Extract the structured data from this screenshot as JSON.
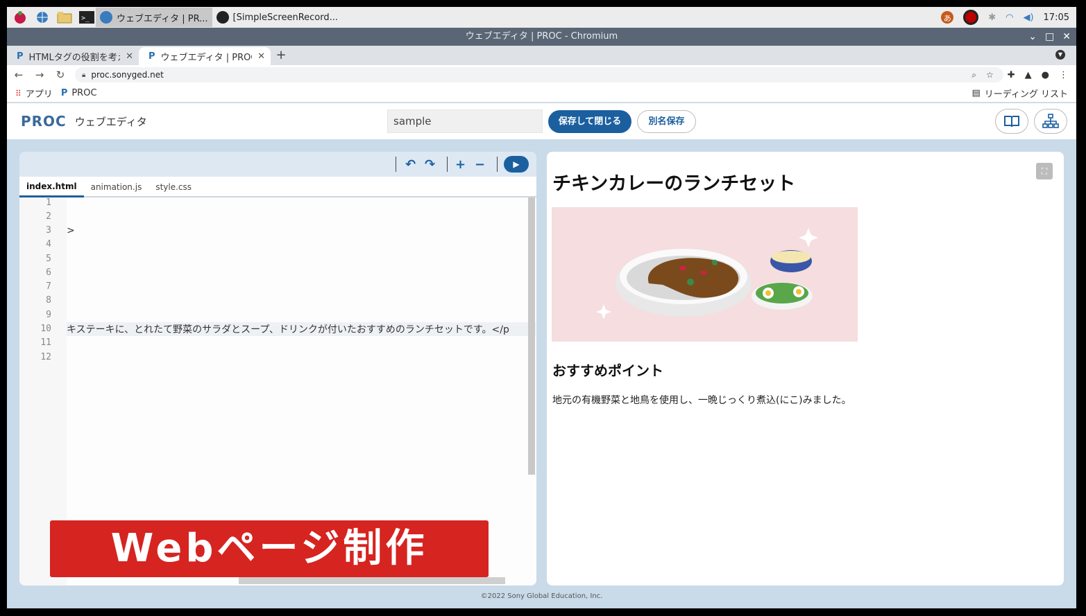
{
  "taskbar": {
    "tasks": [
      "ウェブエディタ | PR...",
      "[SimpleScreenRecord..."
    ],
    "ime": "あ",
    "clock": "17:05"
  },
  "window": {
    "title": "ウェブエディタ | PROC - Chromium"
  },
  "browser": {
    "tabs": [
      {
        "label": "HTMLタグの役割を考え",
        "favicon": "P"
      },
      {
        "label": "ウェブエディタ | PROC",
        "favicon": "P"
      }
    ],
    "url": "proc.sonyged.net",
    "bookmarks": [
      {
        "label": "アプリ"
      },
      {
        "label": "PROC"
      }
    ],
    "reading_list": "リーディング リスト"
  },
  "app": {
    "logo": "PROC",
    "subtitle": "ウェブエディタ",
    "filename": "sample",
    "save_close": "保存して閉じる",
    "save_as": "別名保存"
  },
  "editor": {
    "tabs": [
      "index.html",
      "animation.js",
      "style.css"
    ],
    "line_numbers": [
      "1",
      "2",
      "3",
      "4",
      "5",
      "6",
      "7",
      "8",
      "9",
      "10",
      "11",
      "12"
    ],
    "line3": ">",
    "line10": "キステーキに、とれたて野菜のサラダとスープ、ドリンクが付いたおすすめのランチセットです。</p",
    "banner": "Webページ制作"
  },
  "preview": {
    "title": "チキンカレーのランチセット",
    "heading": "おすすめポイント",
    "paragraph": "地元の有機野菜と地鳥を使用し、一晩じっくり煮込(にこ)みました。"
  },
  "footer": "©2022 Sony Global Education, Inc.",
  "colors": {
    "accent": "#1b5f9f",
    "banner": "#d62421",
    "workspace": "#c9dae9"
  }
}
